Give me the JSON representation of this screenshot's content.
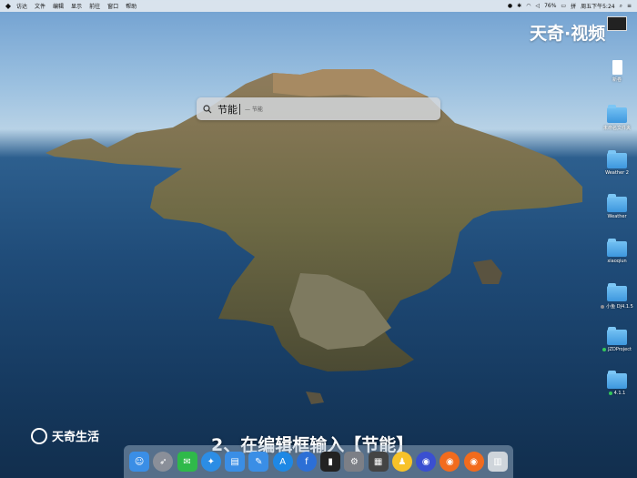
{
  "menubar": {
    "apple": "",
    "items": [
      "访达",
      "文件",
      "编辑",
      "显示",
      "前往",
      "窗口",
      "帮助"
    ],
    "battery": "76%",
    "clock": "周五下午5:24"
  },
  "spotlight": {
    "query": "节能",
    "hint": "— 节能"
  },
  "desktop_icons": [
    {
      "label": "新卷",
      "kind": "file"
    },
    {
      "label": "未命名文件夹",
      "kind": "folder"
    },
    {
      "label": "Weather 2",
      "kind": "folder"
    },
    {
      "label": "Weather",
      "kind": "folder"
    },
    {
      "label": "xiaoqiun",
      "kind": "folder"
    },
    {
      "label": "小鱼 DJ4.1.5",
      "kind": "folder",
      "tag": "#8e8e93"
    },
    {
      "label": "JZDProject",
      "kind": "folder",
      "tag": "#34c759"
    },
    {
      "label": "4.1.1",
      "kind": "folder",
      "tag": "#34c759"
    }
  ],
  "watermark_top": "天奇·视频",
  "watermark_bottom": "天奇生活",
  "subtitle": "2、在编辑框输入【节能】",
  "dock": [
    {
      "icon": "finder-icon",
      "color": "#3a8ee6"
    },
    {
      "icon": "launchpad-icon",
      "color": "#8a8f99"
    },
    {
      "icon": "wechat-icon",
      "color": "#2fb94a"
    },
    {
      "icon": "safari-icon",
      "color": "#2c8de5"
    },
    {
      "icon": "folder-icon",
      "color": "#3a8ee6"
    },
    {
      "icon": "notes-icon",
      "color": "#3a8ee6"
    },
    {
      "icon": "appstore-icon",
      "color": "#1e88e5"
    },
    {
      "icon": "facetime-icon",
      "color": "#2c6fd6"
    },
    {
      "icon": "terminal-icon",
      "color": "#222222"
    },
    {
      "icon": "preferences-icon",
      "color": "#7c7f86"
    },
    {
      "icon": "notes2-icon",
      "color": "#444444"
    },
    {
      "icon": "qq-icon",
      "color": "#f7c229"
    },
    {
      "icon": "firefox-blue-icon",
      "color": "#3a4fd1"
    },
    {
      "icon": "firefox-icon",
      "color": "#f26b1d"
    },
    {
      "icon": "firefox-icon-2",
      "color": "#f26b1d"
    },
    {
      "icon": "trash-icon",
      "color": "#cfd5db"
    }
  ]
}
